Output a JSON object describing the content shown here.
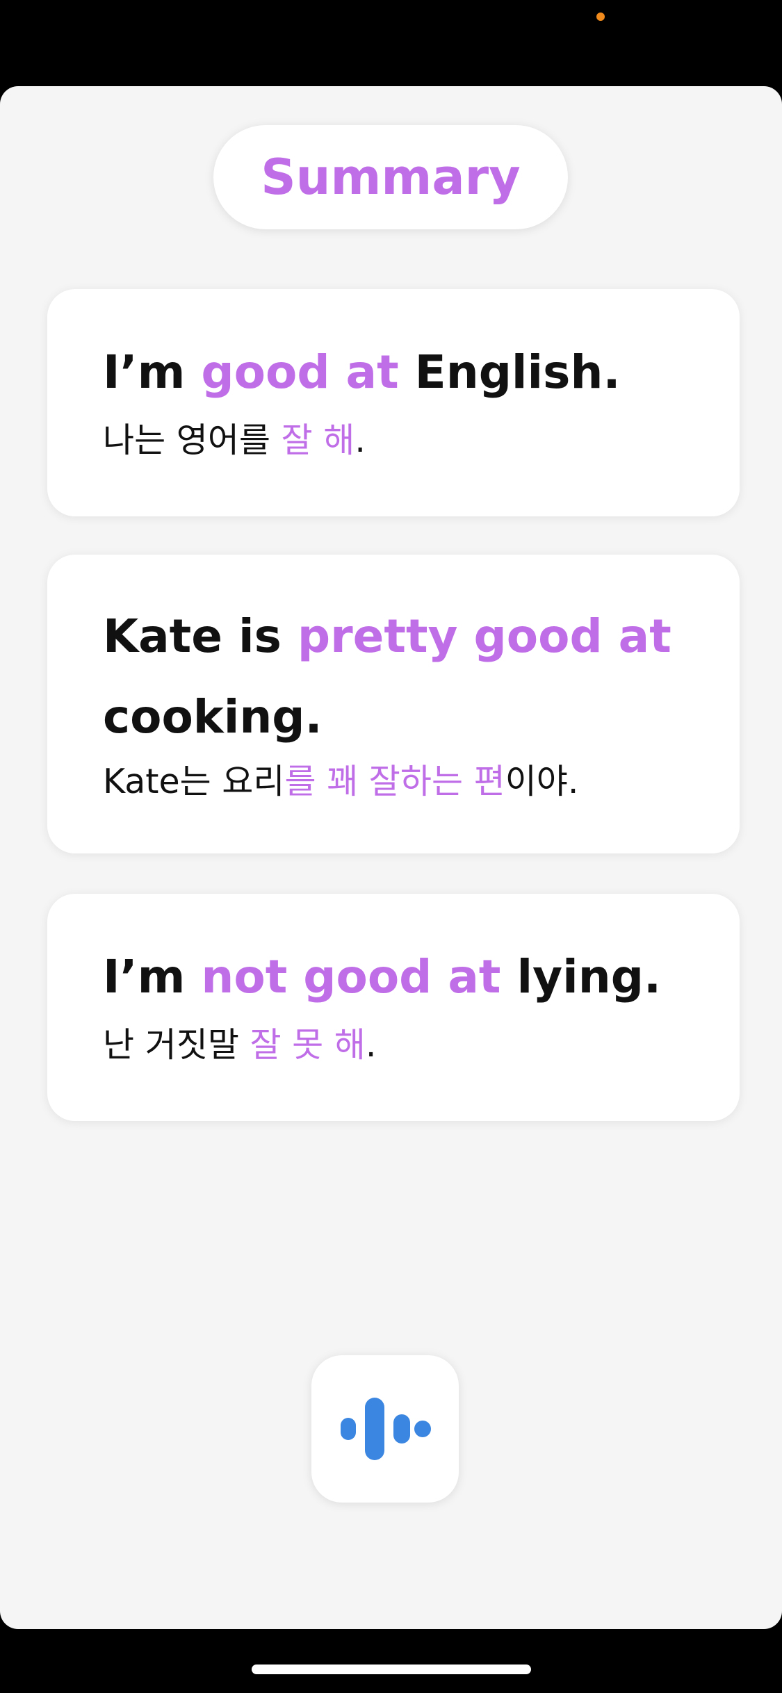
{
  "header": {
    "title": "Summary"
  },
  "cards": [
    {
      "en": [
        {
          "text": "I’m ",
          "hl": false
        },
        {
          "text": "good at",
          "hl": true
        },
        {
          "text": " English.",
          "hl": false
        }
      ],
      "ko": [
        {
          "text": "나는 영어를 ",
          "hl": false
        },
        {
          "text": "잘 해",
          "hl": true
        },
        {
          "text": ".",
          "hl": false
        }
      ]
    },
    {
      "en": [
        {
          "text": "Kate is ",
          "hl": false
        },
        {
          "text": "pretty good at",
          "hl": true
        },
        {
          "text": " cooking.",
          "hl": false
        }
      ],
      "ko": [
        {
          "text": "Kate는 요리",
          "hl": false
        },
        {
          "text": "를 꽤 잘하는 편",
          "hl": true
        },
        {
          "text": "이야.",
          "hl": false
        }
      ]
    },
    {
      "en": [
        {
          "text": "I’m ",
          "hl": false
        },
        {
          "text": "not good at",
          "hl": true
        },
        {
          "text": " lying.",
          "hl": false
        }
      ],
      "ko": [
        {
          "text": "난 거짓말 ",
          "hl": false
        },
        {
          "text": "잘 못 해",
          "hl": true
        },
        {
          "text": ".",
          "hl": false
        }
      ]
    }
  ],
  "voice_button": {
    "icon": "voice-wave-icon"
  },
  "colors": {
    "highlight": "#c06de8",
    "accent_icon": "#3b86e0",
    "text": "#111111",
    "background": "#f5f5f5"
  }
}
